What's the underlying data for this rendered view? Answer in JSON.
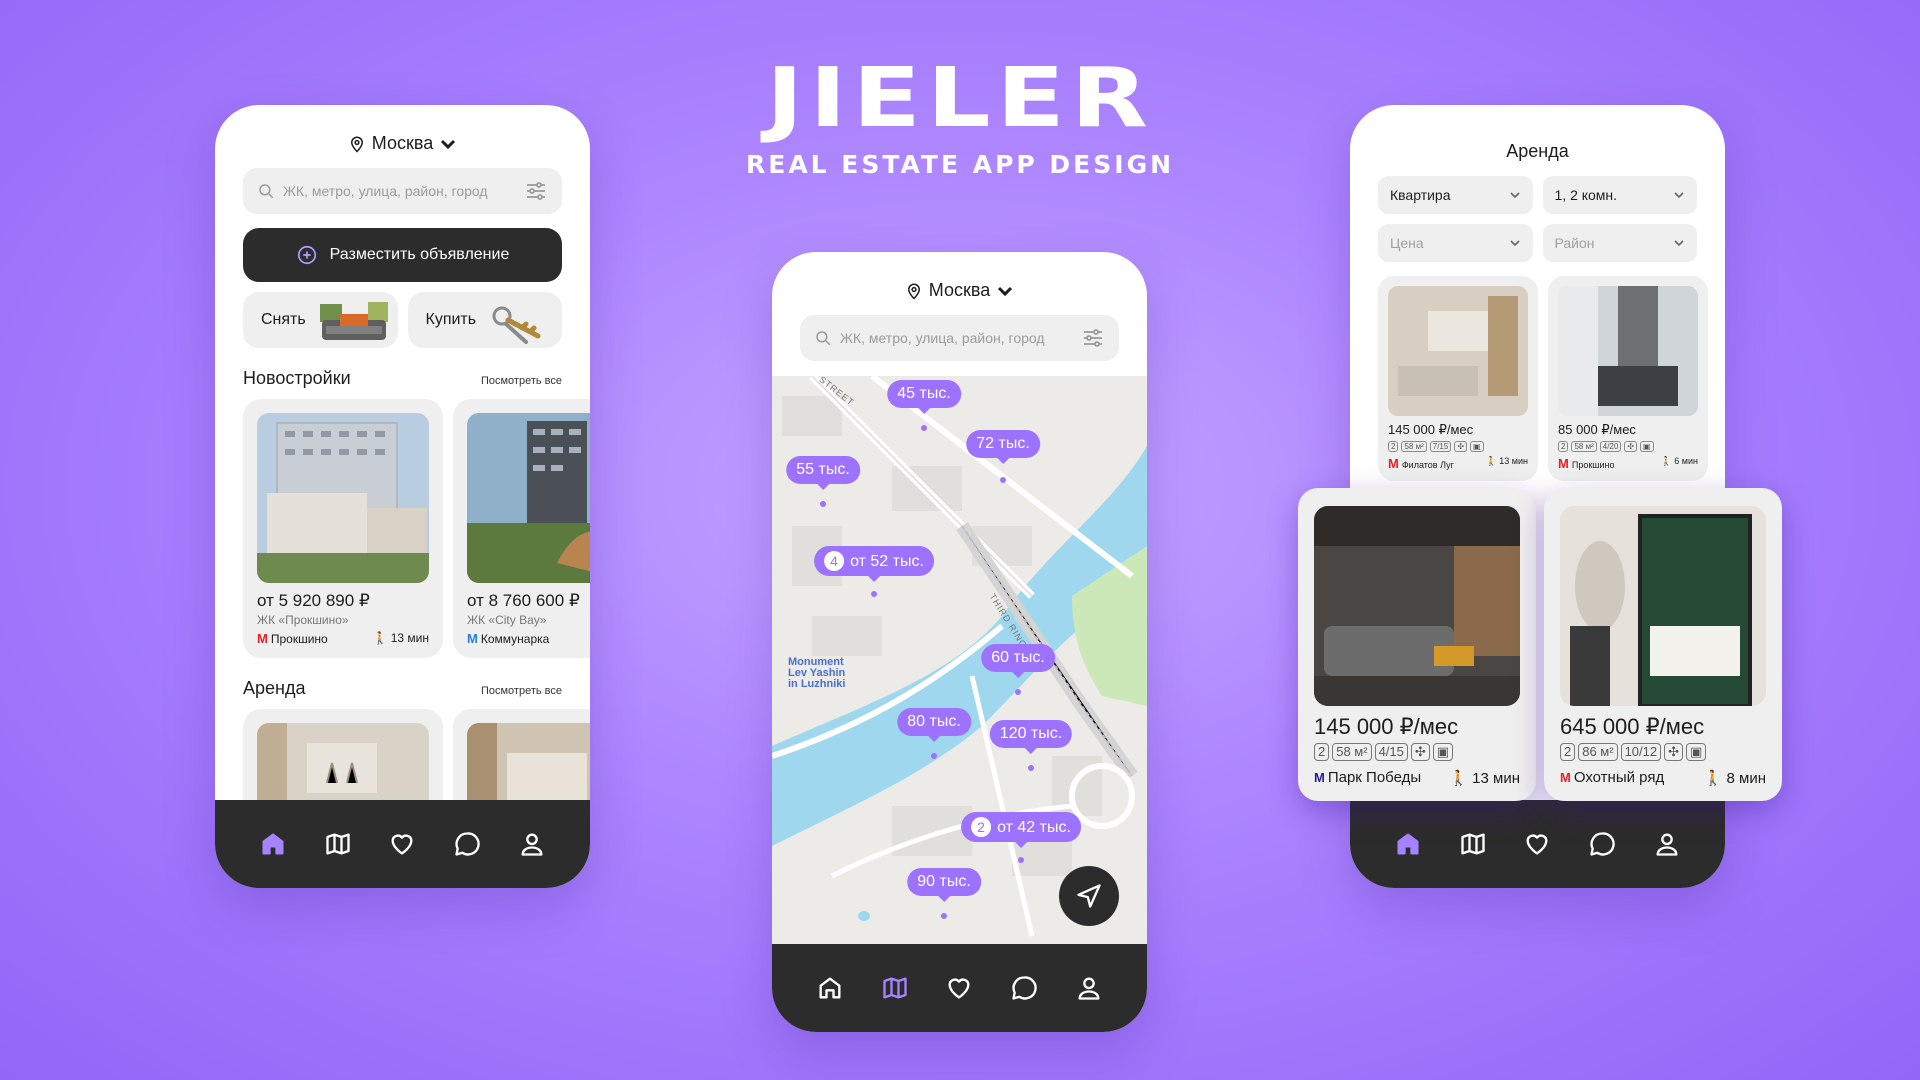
{
  "brand": {
    "title": "JIELER",
    "subtitle": "REAL ESTATE APP DESIGN"
  },
  "home": {
    "city": "Москва",
    "search_placeholder": "ЖК, метро, улица, район, город",
    "post_button": "Разместить объявление",
    "quick": [
      "Снять",
      "Купить"
    ],
    "new_builds": {
      "title": "Новостройки",
      "see_all": "Посмотреть все",
      "items": [
        {
          "price": "от 5 920 890 ₽",
          "complex": "ЖК «Прокшино»",
          "metro": "Прокшино",
          "walk": "13 мин"
        },
        {
          "price": "от 8 760 600 ₽",
          "complex": "ЖК «City Bay»",
          "metro": "Коммунарка",
          "walk": ""
        }
      ]
    },
    "rent": {
      "title": "Аренда",
      "see_all": "Посмотреть все"
    }
  },
  "map_screen": {
    "city": "Москва",
    "search_placeholder": "ЖК, метро, улица, район, город",
    "pins": [
      {
        "label": "45 тыс.",
        "count": ""
      },
      {
        "label": "72 тыс.",
        "count": ""
      },
      {
        "label": "55 тыс.",
        "count": ""
      },
      {
        "label": "от 52 тыс.",
        "count": "4"
      },
      {
        "label": "60 тыс.",
        "count": ""
      },
      {
        "label": "80 тыс.",
        "count": ""
      },
      {
        "label": "120 тыс.",
        "count": ""
      },
      {
        "label": "от 42 тыс.",
        "count": "2"
      },
      {
        "label": "90 тыс.",
        "count": ""
      }
    ],
    "labels": {
      "street": "STREET",
      "ring": "THIRD RING",
      "monument": [
        "Monument",
        "Lev Yashin",
        "in Luzhniki"
      ]
    }
  },
  "rent_screen": {
    "title": "Аренда",
    "filters": [
      {
        "value": "Квартира",
        "empty": false
      },
      {
        "value": "1, 2 комн.",
        "empty": false
      },
      {
        "value": "Цена",
        "empty": true
      },
      {
        "value": "Район",
        "empty": true
      }
    ],
    "small_cards": [
      {
        "price": "145 000 ₽/мес",
        "rooms": "2",
        "area": "58 м²",
        "floor": "7/15",
        "metro": "Филатов Луг",
        "walk": "13 мин"
      },
      {
        "price": "85 000 ₽/мес",
        "rooms": "2",
        "area": "58 м²",
        "floor": "4/20",
        "metro": "Прокшино",
        "walk": "6 мин"
      }
    ],
    "big_cards": [
      {
        "price": "145 000 ₽/мес",
        "rooms": "2",
        "area": "58 м²",
        "floor": "4/15",
        "metro": "Парк Победы",
        "walk": "13 мин"
      },
      {
        "price": "645 000 ₽/мес",
        "rooms": "2",
        "area": "86 м²",
        "floor": "10/12",
        "metro": "Охотный ряд",
        "walk": "8 мин"
      }
    ]
  },
  "colors": {
    "accent": "#9d72ff",
    "dark": "#2c2c2c",
    "card": "#efefef"
  }
}
